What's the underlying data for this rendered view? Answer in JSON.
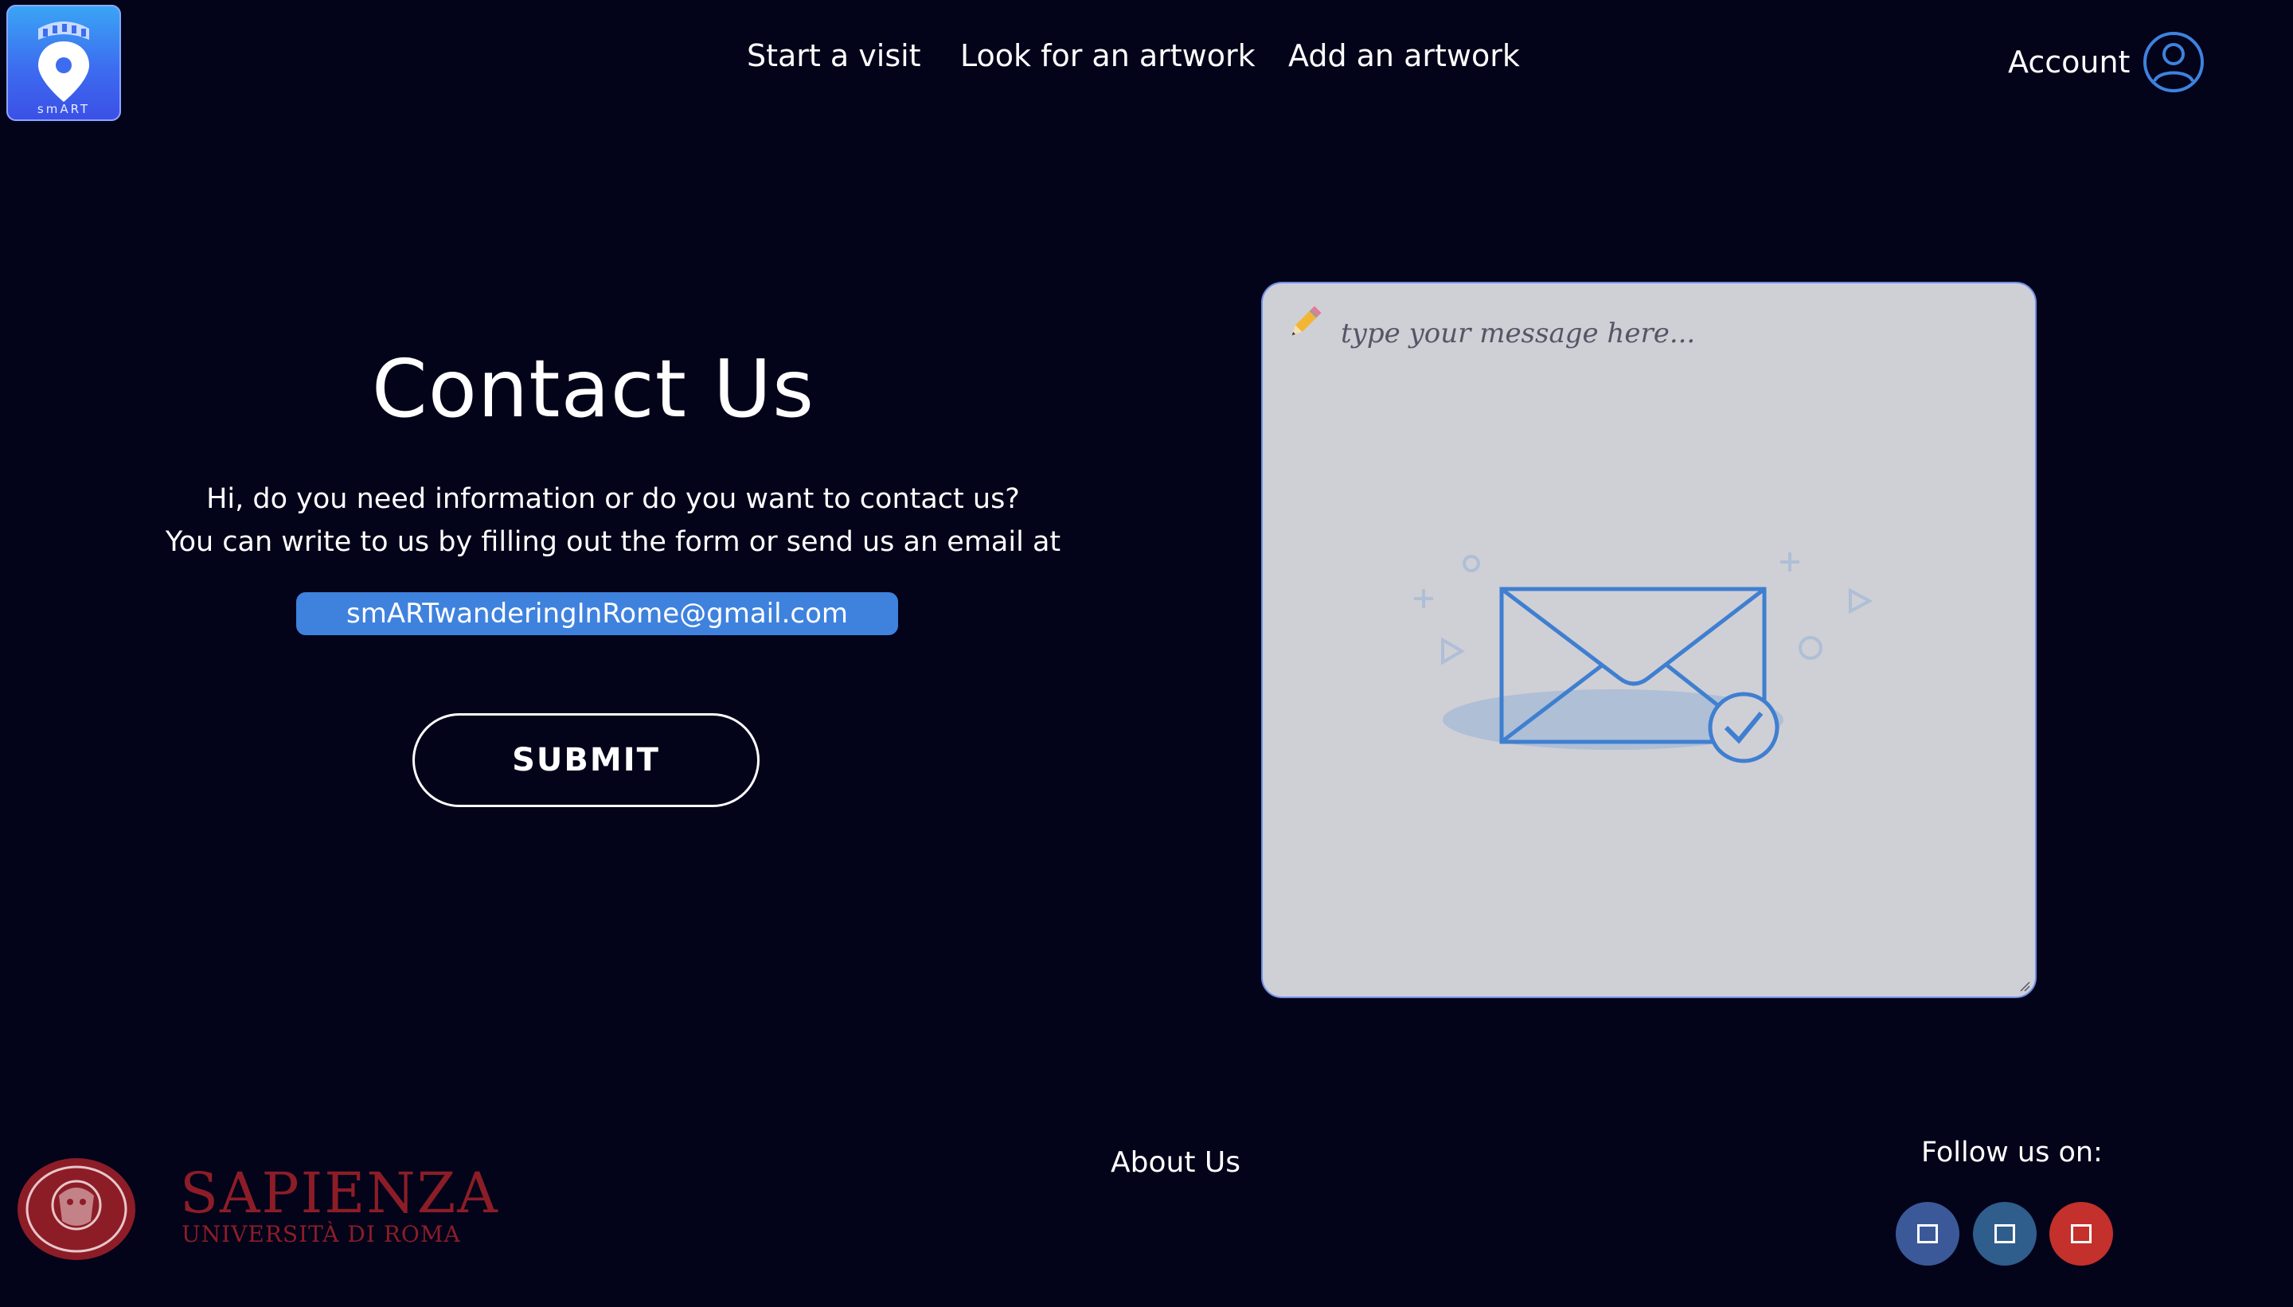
{
  "header": {
    "logo_text": "smART",
    "nav": [
      {
        "label": "Start a visit"
      },
      {
        "label": "Look for an artwork"
      },
      {
        "label": "Add an artwork"
      }
    ],
    "account_label": "Account"
  },
  "main": {
    "title": "Contact Us",
    "description_line1": "Hi, do you need information or do you want to contact us?",
    "description_line2": "You can write to us by filling out the form or send us an email at",
    "email": "smARTwanderingInRome@gmail.com",
    "submit_label": "SUBMIT"
  },
  "message": {
    "placeholder": "type your message here..."
  },
  "footer": {
    "university_name": "SAPIENZA",
    "university_sub": "UNIVERSITÀ DI ROMA",
    "about_label": "About Us",
    "follow_label": "Follow us on:",
    "social": [
      {
        "icon": "facebook-icon",
        "color": "#3b5998"
      },
      {
        "icon": "linkedin-icon",
        "color": "#2f5d8c"
      },
      {
        "icon": "youtube-icon",
        "color": "#c4302b"
      }
    ]
  },
  "colors": {
    "background": "#03031a",
    "accent": "#3f82de",
    "message_box": "#cfcfd6",
    "sapienza": "#8c1d27"
  }
}
